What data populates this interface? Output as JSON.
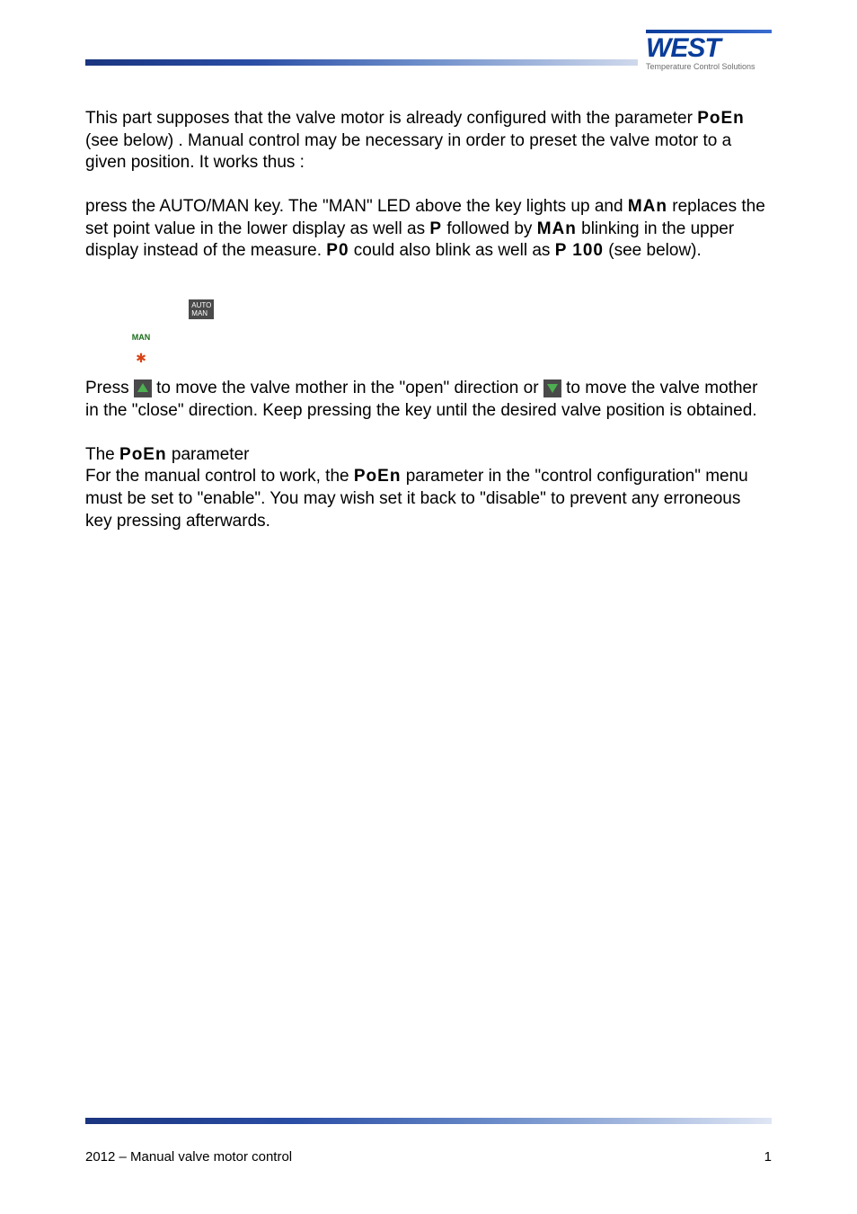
{
  "logo": {
    "brand": "WEST",
    "tagline": "Temperature Control Solutions"
  },
  "section": {
    "intro": "This part supposes that the valve motor is already configured with the parameter PoEn (see below) . Manual control may be necessary in order to preset the valve motor to a given position. It works thus :",
    "step1_a": "press the AUTO/MAN key. The \"MAN\" LED above the key lights up and ",
    "step1_seg1": "MAn",
    "step1_b": " replaces the set point value in the lower display as well as ",
    "step1_seg2": "P",
    "step1_c": " followed by ",
    "step1_seg3": "MAn",
    "step1_d": " blinking in the upper display instead of the measure. ",
    "step1_seg4": "P0",
    "step1_e": " could also blink as well as ",
    "step1_seg5": "P 100",
    "step1_f": " (see below).",
    "icons_line_a": "",
    "step2_a": "Press ",
    "step2_b": " to move the valve mother in the \"open\" direction or ",
    "step2_c": " to move the valve mother in the \"close\" direction. Keep pressing the key until the desired valve position is obtained.",
    "poen_title": "The ",
    "poen_seg": "PoEn",
    "poen_title2": " parameter",
    "poen_body_a": "For the manual control to work, the ",
    "poen_body_b": " parameter in the \"control configuration\" menu must be set to \"enable\". You may wish set it back to \"disable\" to prevent any erroneous key pressing afterwards."
  },
  "auto_man": {
    "top": "AUTO",
    "bot": "MAN"
  },
  "man_badge": {
    "label": "MAN"
  },
  "footer": {
    "left": "2012 – Manual valve motor control",
    "right": "1"
  }
}
